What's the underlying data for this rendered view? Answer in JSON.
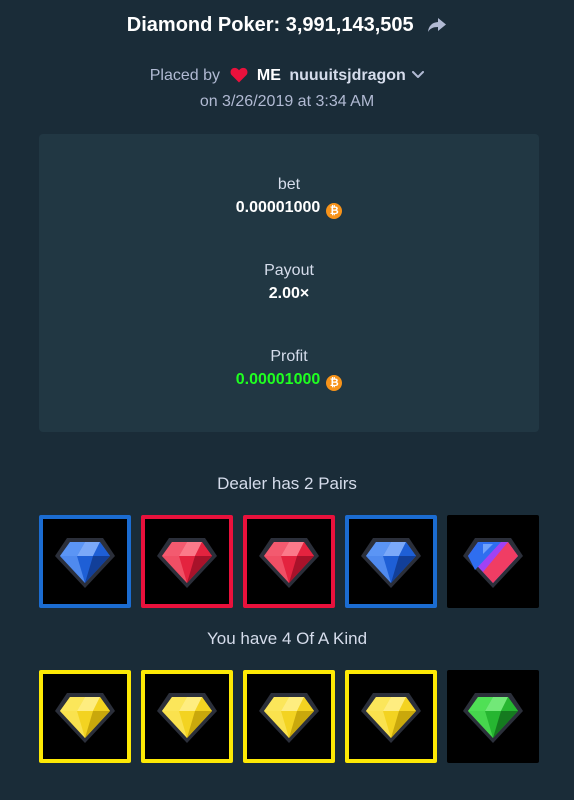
{
  "header": {
    "title": "Diamond Poker: 3,991,143,505",
    "placed_by_label": "Placed by",
    "me_label": "ME",
    "username": "nuuuitsjdragon",
    "datetime": "on 3/26/2019 at 3:34 AM"
  },
  "stats": {
    "bet_label": "bet",
    "bet_value": "0.00001000",
    "payout_label": "Payout",
    "payout_value": "2.00×",
    "profit_label": "Profit",
    "profit_value": "0.00001000",
    "currency_symbol": "₿"
  },
  "dealer": {
    "label": "Dealer has 2 Pairs",
    "cards": [
      "blue",
      "red",
      "red",
      "blue",
      "purple"
    ],
    "highlight": [
      true,
      true,
      true,
      true,
      false
    ]
  },
  "player": {
    "label": "You have 4 Of A Kind",
    "cards": [
      "yellow",
      "yellow",
      "yellow",
      "yellow",
      "green"
    ],
    "highlight": [
      true,
      true,
      true,
      true,
      false
    ]
  },
  "colors": {
    "background": "#1a2c38",
    "panel": "#213743",
    "profit_green": "#1fff20",
    "bitcoin_orange": "#f7931a",
    "heart_red": "#e9113c",
    "border_blue": "#1b6cd1",
    "border_red": "#e9113c",
    "border_yellow": "#fde905"
  },
  "icons": {
    "share": "share-arrow-icon",
    "heart": "heart-icon",
    "chevron": "chevron-down-icon",
    "coin": "bitcoin-icon"
  }
}
